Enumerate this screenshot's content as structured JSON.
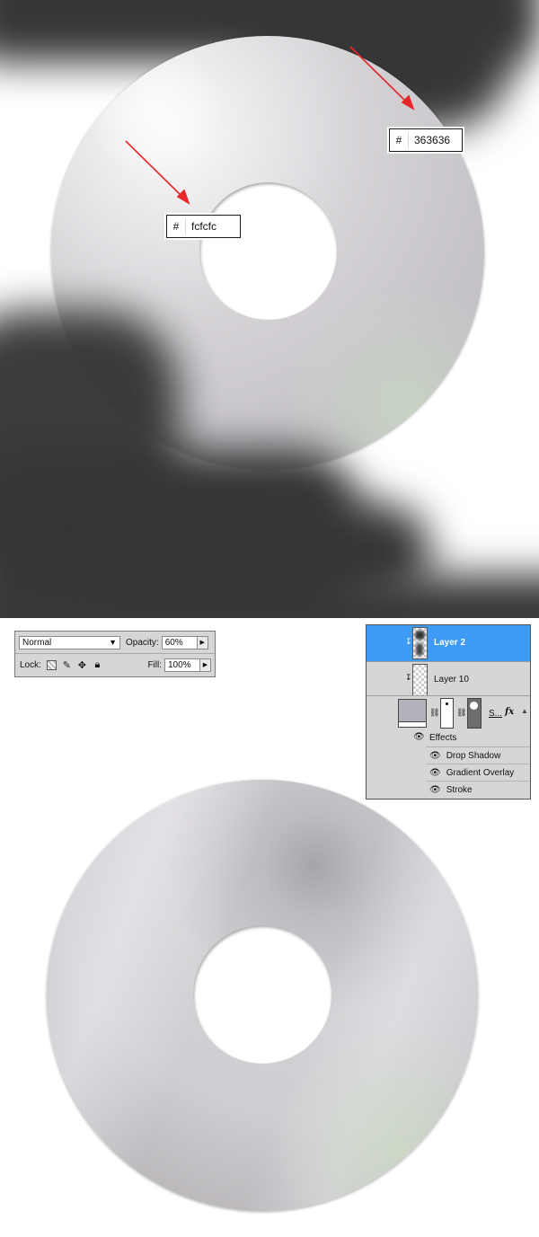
{
  "colors": {
    "dark_shape": "#363636",
    "highlight": "#fcfcfc",
    "arrow": "#e8272b",
    "selection": "#3d9bf6",
    "panel_bg": "#d6d6d6"
  },
  "top_artwork": {
    "picker_dark": {
      "hash": "#",
      "value": "363636"
    },
    "picker_light": {
      "hash": "#",
      "value": "fcfcfc"
    }
  },
  "blending": {
    "mode": "Normal",
    "opacity_label": "Opacity:",
    "opacity_value": "60%",
    "lock_label": "Lock:",
    "fill_label": "Fill:",
    "fill_value": "100%",
    "lock_icons": [
      "lock-transparent-icon",
      "brush-icon",
      "move-icon",
      "padlock-icon"
    ]
  },
  "layers": {
    "rows": [
      {
        "name": "Layer 2",
        "selected": true
      },
      {
        "name": "Layer 10",
        "selected": false
      }
    ],
    "shape_layer_name": "S...",
    "fx_badge": "fx",
    "effects_label": "Effects",
    "effects": [
      "Drop Shadow",
      "Gradient Overlay",
      "Stroke"
    ]
  }
}
